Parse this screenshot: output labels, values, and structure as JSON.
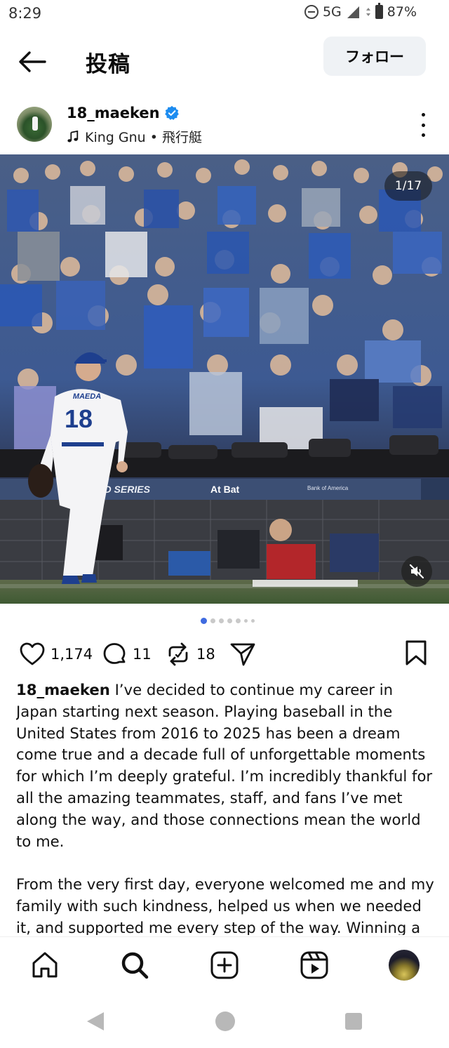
{
  "status_bar": {
    "time": "8:29",
    "network": "5G",
    "battery": "87%"
  },
  "header": {
    "title": "投稿",
    "follow_label": "フォロー"
  },
  "author": {
    "username": "18_maeken",
    "music": "King Gnu • 飛行艇"
  },
  "photo": {
    "counter": "1/17",
    "jersey_name": "MAEDA",
    "jersey_number": "18",
    "banner_left": "LD SERIES",
    "banner_mid": "At Bat",
    "banner_right": "Bank of America"
  },
  "carousel": {
    "total_dots": 7,
    "active_index": 0
  },
  "actions": {
    "likes": "1,174",
    "comments": "11",
    "reposts": "18"
  },
  "caption": {
    "username": "18_maeken",
    "paragraph1": "I’ve decided to continue my career in Japan starting next season. Playing baseball in the United States from 2016 to 2025 has been a dream come true and a decade full of unforgettable moments for which I’m deeply grateful. I’m incredibly thankful for all the amazing teammates, staff, and fans I’ve met along the way, and those connections mean the world to me.",
    "paragraph2": "From the very first day, everyone welcomed me and my family with such kindness, helped us when we needed it, and supported me every step of the way. Winning a division title, celebrating with champagne, competing"
  },
  "icons": {
    "back": "arrow-left-icon",
    "verified": "verified-badge-icon",
    "music": "music-note-icon",
    "more": "more-vertical-icon",
    "mute": "speaker-muted-icon",
    "like": "heart-icon",
    "comment": "comment-bubble-icon",
    "repost": "repost-icon",
    "share": "send-icon",
    "save": "bookmark-icon",
    "home": "home-icon",
    "search": "search-icon",
    "create": "plus-square-icon",
    "reels": "reels-icon"
  },
  "colors": {
    "accent": "#3f6be0",
    "verified": "#1d8cf0",
    "follow_bg": "#eff2f5"
  }
}
